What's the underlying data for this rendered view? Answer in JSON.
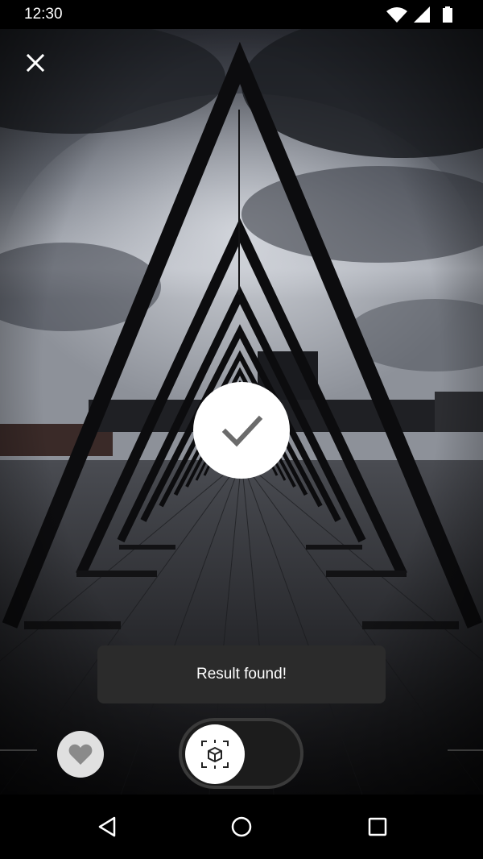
{
  "status_bar": {
    "time": "12:30",
    "icons": [
      "wifi-icon",
      "cellular-signal-icon",
      "battery-icon"
    ]
  },
  "top_bar": {
    "close_icon": "close-icon"
  },
  "result": {
    "check_icon": "checkmark-icon",
    "toast_text": "Result found!"
  },
  "bottom_controls": {
    "favorite_icon": "heart-icon",
    "toggle_icon": "ar-cube-icon",
    "toggle_state": "off"
  },
  "nav_bar": {
    "icons": [
      "back-triangle-icon",
      "home-circle-icon",
      "recents-square-icon"
    ]
  },
  "colors": {
    "toast_bg": "#2b2b2b",
    "check_circle": "#ffffff",
    "check_mark": "#6b6b6b",
    "fav_bg": "#e0e0e0"
  }
}
